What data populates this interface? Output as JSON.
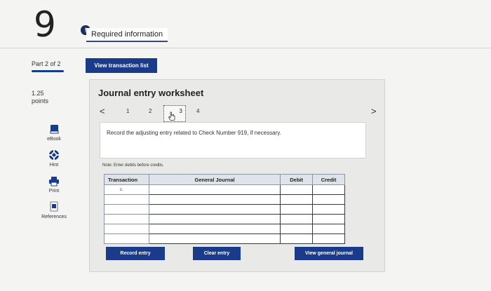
{
  "question": {
    "number": "9"
  },
  "header": {
    "info_badge": "!",
    "tab_label": "Required information"
  },
  "part": {
    "label": "Part 2 of 2",
    "progress": 1.0
  },
  "points": {
    "value": "1.25",
    "unit": "points"
  },
  "tools": [
    {
      "label": "eBook",
      "icon": "book-icon"
    },
    {
      "label": "Hint",
      "icon": "hint-icon"
    },
    {
      "label": "Print",
      "icon": "print-icon"
    },
    {
      "label": "References",
      "icon": "references-icon"
    }
  ],
  "view_transactions_label": "View transaction list",
  "worksheet": {
    "title": "Journal entry worksheet",
    "prev": "<",
    "next": ">",
    "pages": [
      "1",
      "2",
      "3",
      "4"
    ],
    "active_page": "3",
    "instruction": "Record the adjusting entry related to Check Number 919, if necessary.",
    "note": "Note: Enter debits before credits.",
    "table": {
      "headers": [
        "Transaction",
        "General Journal",
        "Debit",
        "Credit"
      ],
      "first_transaction": "c.",
      "row_count": 6
    },
    "buttons": {
      "record": "Record entry",
      "clear": "Clear entry",
      "view_journal": "View general journal"
    }
  },
  "colors": {
    "brand_blue": "#1a3b8a",
    "badge_navy": "#1a2c5b"
  }
}
